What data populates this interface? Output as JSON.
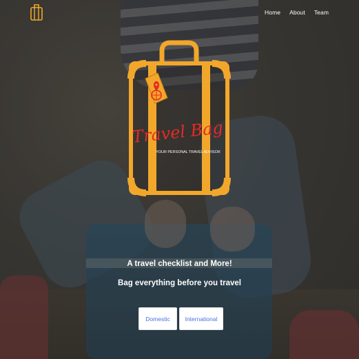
{
  "nav": {
    "links": [
      "Home",
      "About",
      "Team"
    ]
  },
  "logo": {
    "title": "Travel Bag",
    "subtitle": "YOUR PERSONAL TRAVEL ADVISOR"
  },
  "hero": {
    "line1": "A travel checklist and More!",
    "line2": "Bag everything before you travel"
  },
  "buttons": {
    "domestic": "Domestic",
    "international": "International"
  },
  "colors": {
    "logo_orange": "#f2a72b",
    "logo_red": "#e62a24",
    "button_text": "#4a6ee0"
  },
  "icons": {
    "brand": "suitcase-icon",
    "tag": "globe-pin-icon"
  }
}
